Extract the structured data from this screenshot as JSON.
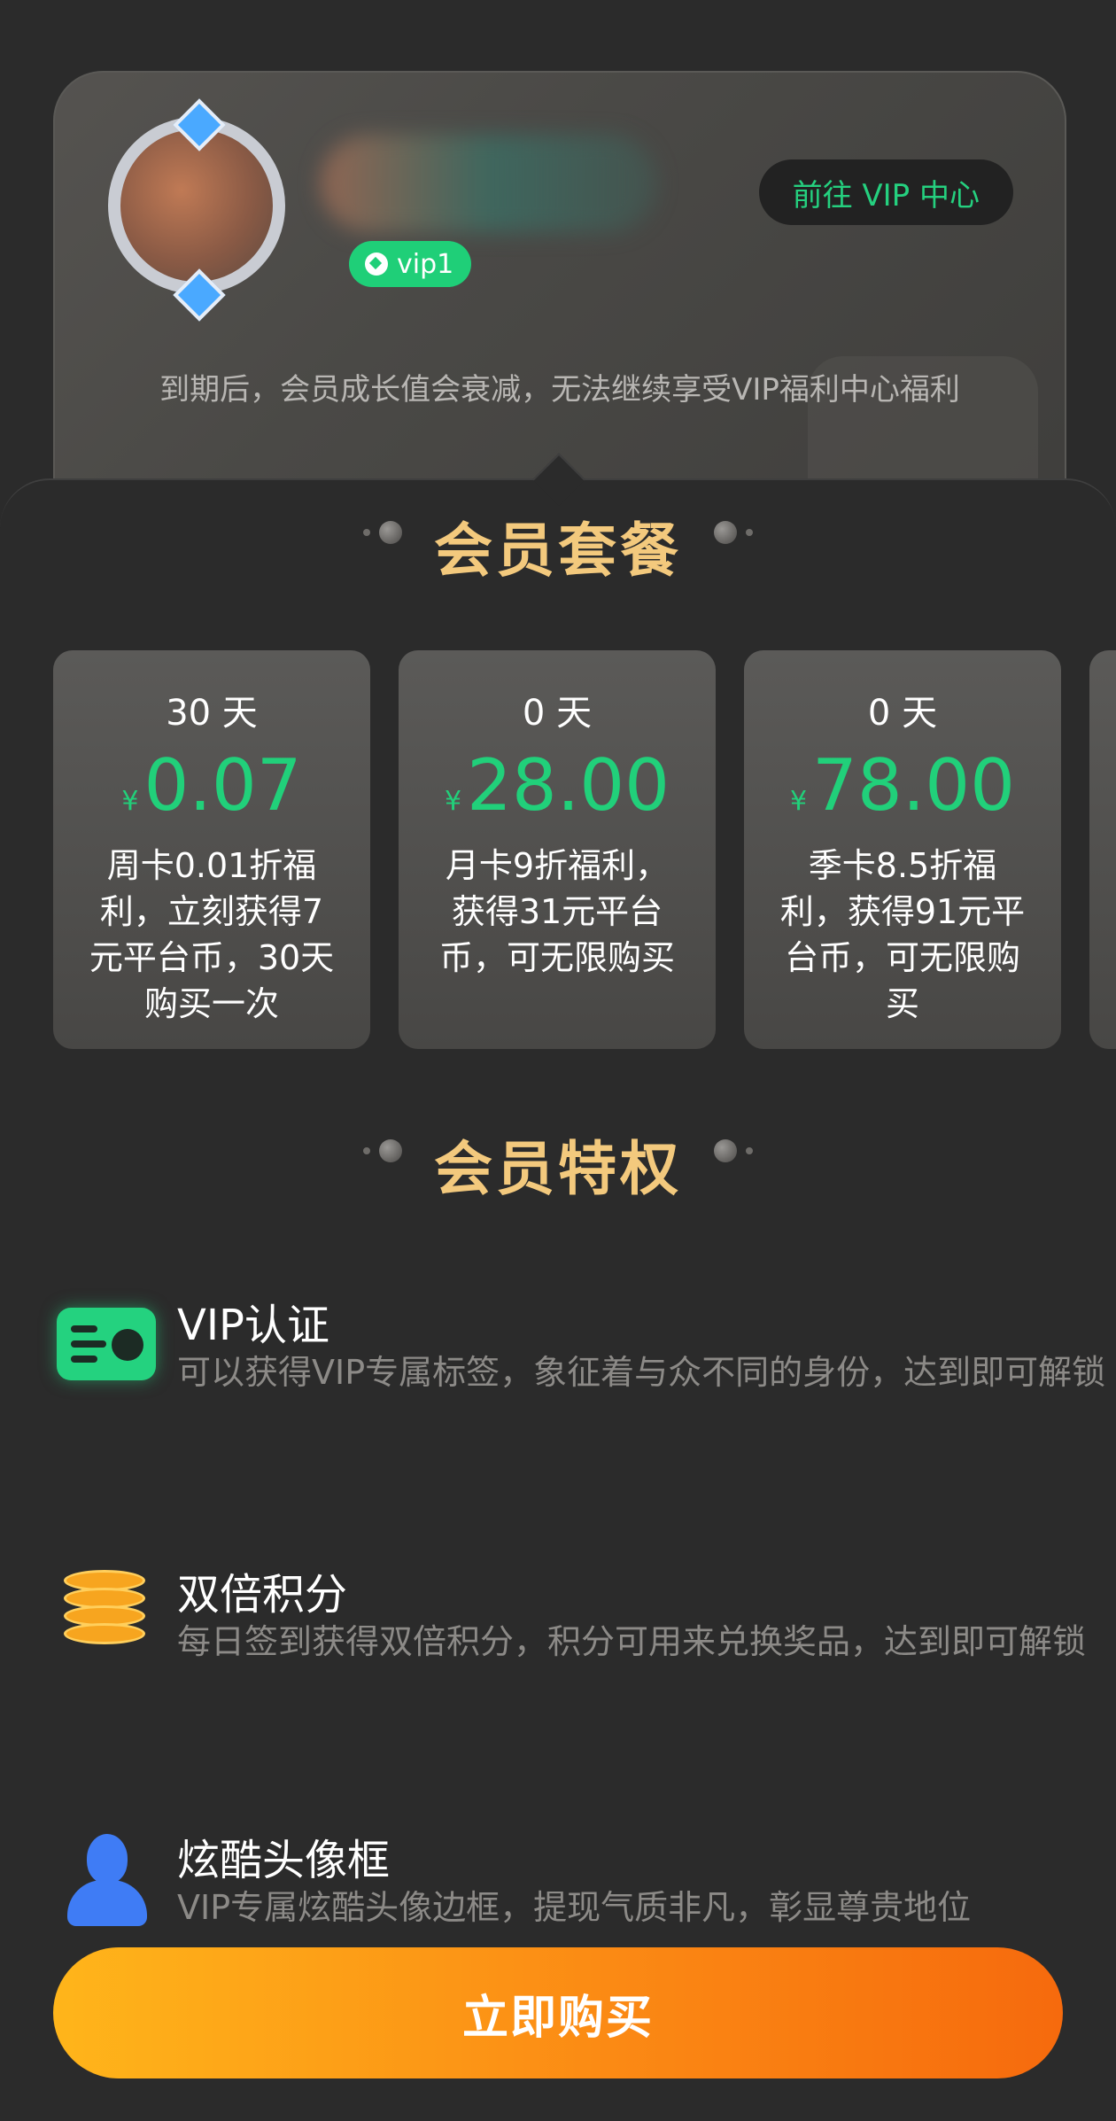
{
  "profile": {
    "vip_level": "vip1",
    "vip_center_button": "前往 VIP 中心",
    "expiry_note": "到期后，会员成长值会衰减，无法继续享受VIP福利中心福利"
  },
  "packages_section": {
    "title": "会员套餐",
    "packages": [
      {
        "days": "30 天",
        "currency": "¥",
        "price": "0.07",
        "desc": "周卡0.01折福利，立刻获得7元平台币，30天购买一次"
      },
      {
        "days": "0 天",
        "currency": "¥",
        "price": "28.00",
        "desc": "月卡9折福利，获得31元平台币，可无限购买"
      },
      {
        "days": "0 天",
        "currency": "¥",
        "price": "78.00",
        "desc": "季卡8.5折福利，获得91元平台币，可无限购买"
      }
    ]
  },
  "privileges_section": {
    "title": "会员特权",
    "items": [
      {
        "title": "VIP认证",
        "desc": "可以获得VIP专属标签，象征着与众不同的身份，达到即可解锁"
      },
      {
        "title": "双倍积分",
        "desc": "每日签到获得双倍积分，积分可用来兑换奖品，达到即可解锁"
      },
      {
        "title": "炫酷头像框",
        "desc": "VIP专属炫酷头像边框，提现气质非凡，彰显尊贵地位"
      }
    ]
  },
  "buy_button": "立即购买",
  "colors": {
    "accent_green": "#21d07a",
    "title_gold": "#f3c97d",
    "buy_orange_start": "#ffb51a",
    "buy_orange_end": "#f66a0d"
  },
  "icons": [
    "vip-cert-icon",
    "coins-icon",
    "user-avatar-icon",
    "diamond-icon"
  ]
}
